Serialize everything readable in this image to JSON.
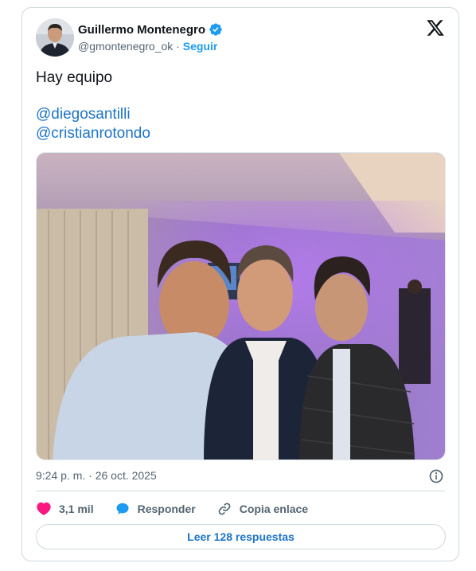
{
  "author": {
    "name": "Guillermo Montenegro",
    "handle": "@gmontenegro_ok",
    "separator": " · ",
    "follow_label": "Seguir"
  },
  "tweet": {
    "text": "Hay equipo",
    "mentions": [
      "@diegosantilli",
      "@cristianrotondo"
    ]
  },
  "photo": {
    "caption_icon": "photo"
  },
  "timestamp": "9:24 p. m. · 26 oct. 2025",
  "actions": {
    "likes": "3,1 mil",
    "reply_label": "Responder",
    "copy_label": "Copia enlace"
  },
  "read_replies_label": "Leer 128 respuestas",
  "colors": {
    "accent": "#1d9bf0",
    "link": "#1d74c8",
    "like": "#f91880",
    "muted": "#536471",
    "border": "#cfd9de"
  },
  "icons": {
    "verified": "verified-badge-icon",
    "x_logo": "x-logo-icon",
    "info": "info-icon",
    "like": "heart-icon",
    "reply": "speech-bubble-icon",
    "copy": "link-icon"
  }
}
